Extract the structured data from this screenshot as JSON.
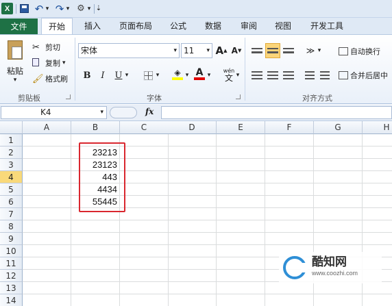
{
  "qat": {
    "app_icon": "X",
    "undo_glyph": "↶",
    "redo_glyph": "↷",
    "dropdown_glyph": "▾",
    "customize_glyph": "⚙",
    "more_glyph": "⇣"
  },
  "tabs": [
    "文件",
    "开始",
    "插入",
    "页面布局",
    "公式",
    "数据",
    "审阅",
    "视图",
    "开发工具"
  ],
  "clipboard": {
    "paste": "粘贴",
    "cut": "剪切",
    "copy": "复制",
    "format_painter": "格式刷",
    "group_label": "剪贴板"
  },
  "font": {
    "name": "宋体",
    "size": "11",
    "grow": "A",
    "shrink": "A",
    "bold": "B",
    "italic": "I",
    "underline": "U",
    "font_color_glyph": "A",
    "wen": "wén",
    "wen_char": "文",
    "group_label": "字体"
  },
  "alignment": {
    "wrap_text": "自动换行",
    "merge_center": "合并后居中",
    "group_label": "对齐方式"
  },
  "formula_bar": {
    "name_box": "K4",
    "fx": "fx",
    "value": ""
  },
  "sheet": {
    "columns": [
      "A",
      "B",
      "C",
      "D",
      "E",
      "F",
      "G",
      "H"
    ],
    "rows": [
      "1",
      "2",
      "3",
      "4",
      "5",
      "6",
      "7",
      "8",
      "9",
      "10",
      "11",
      "12",
      "13",
      "14",
      "15"
    ],
    "selected_row": "4",
    "column_b_values": [
      "23213",
      "23123",
      "443",
      "4434",
      "55445"
    ]
  },
  "watermark": {
    "name": "酷知网",
    "url": "www.coozhi.com"
  },
  "colors": {
    "file_tab": "#1e7145",
    "highlight_border": "#d9262e",
    "selected_row_header": "#f9d97a"
  }
}
